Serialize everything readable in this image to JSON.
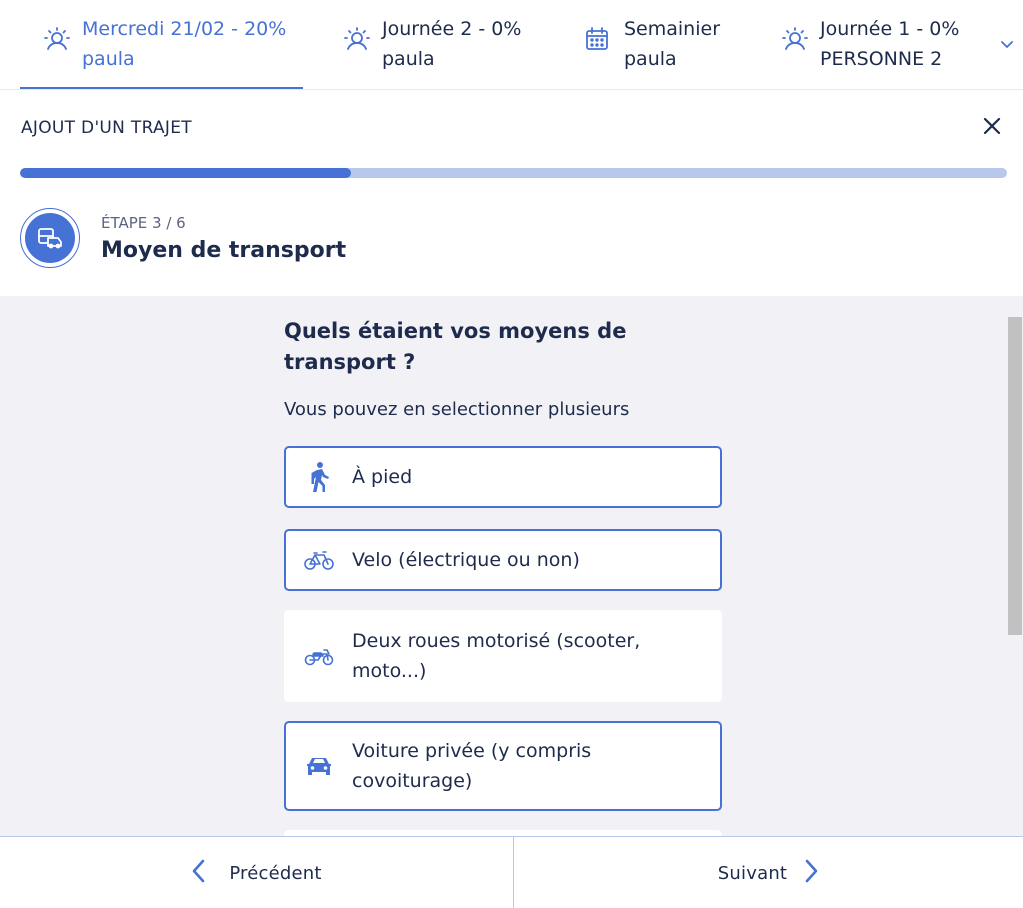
{
  "tabs": [
    {
      "line1": "Mercredi 21/02 - 20%",
      "line2": "paula",
      "icon": "sun-person-icon",
      "active": true
    },
    {
      "line1": "Journée 2 - 0%",
      "line2": "paula",
      "icon": "sun-person-icon",
      "active": false
    },
    {
      "line1": "Semainier",
      "line2": "paula",
      "icon": "calendar-icon",
      "active": false
    },
    {
      "line1": "Journée 1 - 0%",
      "line2": "PERSONNE 2",
      "icon": "sun-person-icon",
      "active": false
    }
  ],
  "header": {
    "title": "AJOUT D'UN TRAJET",
    "close_icon": "close-icon"
  },
  "progress": {
    "fraction": 0.335
  },
  "step": {
    "number": "ÉTAPE 3 / 6",
    "title": "Moyen de transport",
    "icon": "bus-car-icon"
  },
  "question": {
    "title": "Quels étaient vos moyens de transport ?",
    "hint": "Vous pouvez en selectionner plusieurs"
  },
  "options": [
    {
      "label": "À pied",
      "icon": "walking-person-icon",
      "selected": true
    },
    {
      "label": "Velo (électrique ou non)",
      "icon": "bicycle-icon",
      "selected": true
    },
    {
      "label": "Deux roues motorisé (scooter, moto...)",
      "icon": "motorcycle-icon",
      "selected": false
    },
    {
      "label": "Voiture privée (y compris covoiturage)",
      "icon": "car-icon",
      "selected": true
    }
  ],
  "footer": {
    "prev_label": "Précédent",
    "next_label": "Suivant"
  },
  "colors": {
    "accent": "#4671d5",
    "text": "#1e2b4d",
    "panel_bg": "#f2f2f6",
    "progress_track": "#b8c8ec"
  }
}
